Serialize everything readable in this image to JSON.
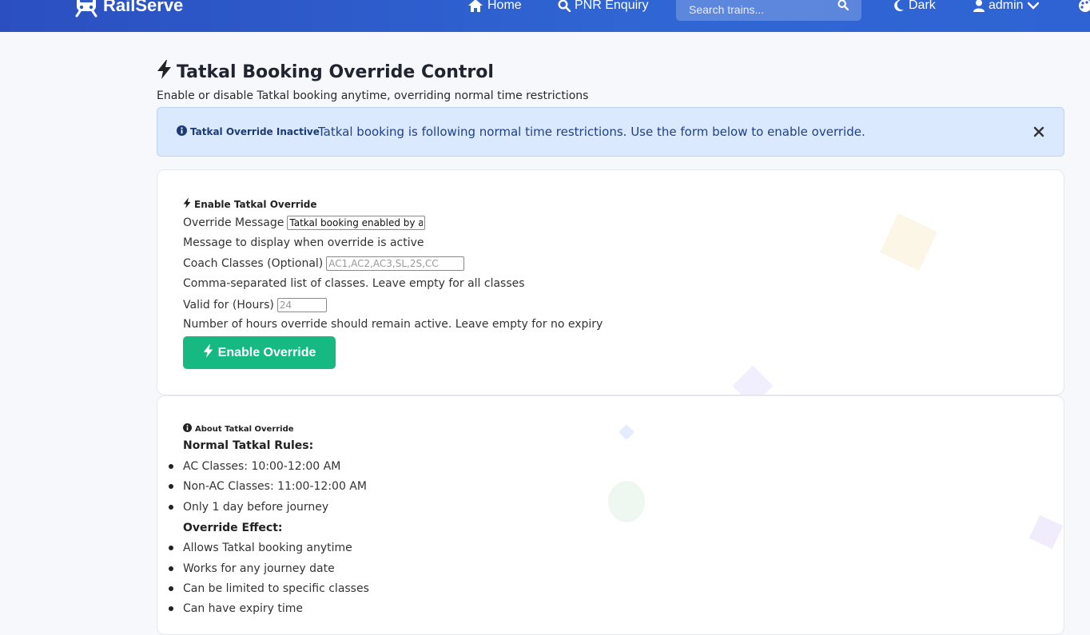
{
  "navbar": {
    "brand": "RailServe",
    "home_label": "Home",
    "pnr_label": "PNR Enquiry",
    "search_placeholder": "Search trains...",
    "theme_label": "Dark",
    "user_label": "admin"
  },
  "page": {
    "title": "Tatkal Booking Override Control",
    "subtitle": "Enable or disable Tatkal booking anytime, overriding normal time restrictions"
  },
  "alert": {
    "badge": "Tatkal Override Inactive",
    "message": "Tatkal booking is following normal time restrictions. Use the form below to enable override."
  },
  "override_form": {
    "heading": "Enable Tatkal Override",
    "message_label": "Override Message",
    "message_value": "Tatkal booking enabled by admin",
    "message_help": "Message to display when override is active",
    "classes_label": "Coach Classes (Optional)",
    "classes_placeholder": "AC1,AC2,AC3,SL,2S,CC",
    "classes_help": "Comma-separated list of classes. Leave empty for all classes",
    "hours_label": "Valid for (Hours)",
    "hours_placeholder": "24",
    "hours_help": "Number of hours override should remain active. Leave empty for no expiry",
    "submit_label": "Enable Override"
  },
  "about": {
    "heading": "About Tatkal Override",
    "normal_title": "Normal Tatkal Rules:",
    "normal_rules": [
      "AC Classes: 10:00-12:00 AM",
      "Non-AC Classes: 11:00-12:00 AM",
      "Only 1 day before journey"
    ],
    "effect_title": "Override Effect:",
    "effects": [
      "Allows Tatkal booking anytime",
      "Works for any journey date",
      "Can be limited to specific classes",
      "Can have expiry time"
    ]
  },
  "colors": {
    "navbar": "#2e5ac9",
    "alert_bg": "#dbe9ff",
    "button": "#16b981"
  },
  "icons": {
    "brand": "train-icon",
    "home": "home-icon",
    "pnr": "search-icon",
    "search": "search-icon",
    "theme": "moon-icon",
    "user": "user-icon",
    "dropdown": "chevron-down-icon",
    "title": "bolt-icon",
    "alert": "info-circle-icon",
    "close": "close-icon",
    "form": "bolt-icon",
    "about": "info-circle-icon"
  }
}
